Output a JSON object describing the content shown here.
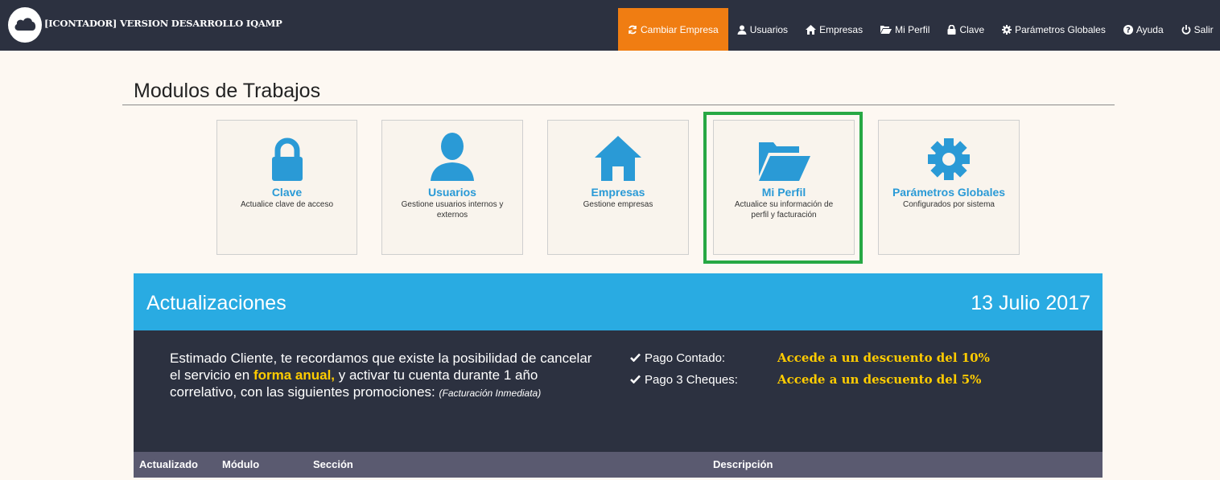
{
  "app": {
    "title": "[ICONTADOR] VERSION DESARROLLO IQAMP"
  },
  "nav": {
    "cambiar_empresa": "Cambiar Empresa",
    "usuarios": "Usuarios",
    "empresas": "Empresas",
    "mi_perfil": "Mi Perfil",
    "clave": "Clave",
    "parametros": "Parámetros Globales",
    "ayuda": "Ayuda",
    "salir": "Salir"
  },
  "page": {
    "title": "Modulos de Trabajos"
  },
  "modules": [
    {
      "title": "Clave",
      "desc": "Actualice clave de acceso",
      "icon": "lock-icon"
    },
    {
      "title": "Usuarios",
      "desc": "Gestione usuarios internos y externos",
      "icon": "user-icon"
    },
    {
      "title": "Empresas",
      "desc": "Gestione empresas",
      "icon": "home-icon"
    },
    {
      "title": "Mi Perfil",
      "desc": "Actualice su información de perfil y facturación",
      "icon": "folder-open-icon"
    },
    {
      "title": "Parámetros Globales",
      "desc": "Configurados por sistema",
      "icon": "gear-icon"
    }
  ],
  "updates": {
    "title": "Actualizaciones",
    "date": "13 Julio 2017",
    "message_part1": "Estimado Cliente, te recordamos que existe la posibilidad de cancelar el servicio en ",
    "message_highlight": "forma anual,",
    "message_part2": " y activar tu cuenta durante 1 año correlativo, con las siguientes promociones: ",
    "message_note": "(Facturación Inmediata)",
    "promos": [
      {
        "label": "Pago Contado:",
        "value": "Accede a un descuento del 10%"
      },
      {
        "label": "Pago 3 Cheques:",
        "value": "Accede a un descuento del 5%"
      }
    ]
  },
  "table": {
    "headers": [
      "Actualizado",
      "Módulo",
      "Sección",
      "Descripción"
    ]
  },
  "colors": {
    "topbar": "#2c3140",
    "accent_orange": "#f07d12",
    "accent_blue": "#29abe2",
    "highlight_green": "#27a844",
    "promo_yellow": "#ffcc00"
  }
}
